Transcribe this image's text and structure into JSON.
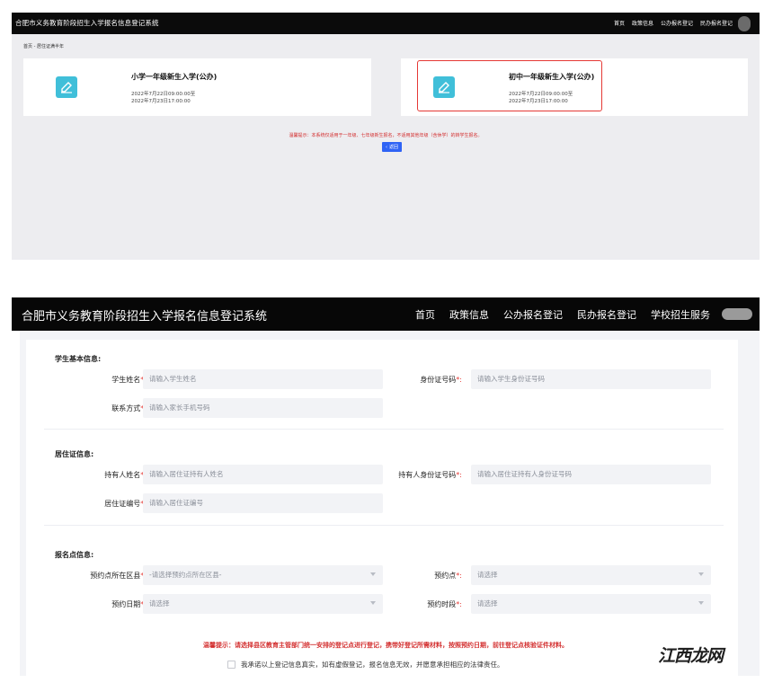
{
  "top": {
    "system_title": "合肥市义务教育阶段招生入学报名信息登记系统",
    "menu": [
      "首页",
      "政策信息",
      "公办报名登记",
      "民办报名登记"
    ],
    "breadcrumb": "首页 - 居住证满半年",
    "cards": [
      {
        "name": "小学一年级新生入学(公办)",
        "time1": "2022年7月22日09:00:00至",
        "time2": "2022年7月23日17:00:00"
      },
      {
        "name": "初中一年级新生入学(公办)",
        "time1": "2022年7月22日09:00:00至",
        "time2": "2022年7月23日17:00:00"
      }
    ],
    "tip": "温馨提示：本系统仅适用于一年级、七年级新生报名，不适用其他年级（含休学）的转学生报名。",
    "back_label": "返回"
  },
  "bottom": {
    "system_title": "合肥市义务教育阶段招生入学报名信息登记系统",
    "menu": [
      "首页",
      "政策信息",
      "公办报名登记",
      "民办报名登记",
      "学校招生服务"
    ],
    "sections": {
      "student": {
        "title": "学生基本信息:",
        "name_label": "学生姓名",
        "name_placeholder": "请输入学生姓名",
        "id_label": "身份证号码",
        "id_placeholder": "请输入学生身份证号码",
        "contact_label": "联系方式",
        "contact_placeholder": "请输入家长手机号码"
      },
      "residence": {
        "title": "居住证信息:",
        "holder_label": "持有人姓名",
        "holder_placeholder": "请输入居住证持有人姓名",
        "holder_id_label": "持有人身份证号码",
        "holder_id_placeholder": "请输入居住证持有人身份证号码",
        "number_label": "居住证编号",
        "number_placeholder": "请输入居住证编号"
      },
      "registration": {
        "title": "报名点信息:",
        "district_label": "预约点所在区县",
        "district_value": "-请选择预约点所在区县-",
        "point_label": "预约点",
        "point_value": "请选择",
        "date_label": "预约日期",
        "date_value": "请选择",
        "slot_label": "预约时段",
        "slot_value": "请选择"
      }
    },
    "tip": "温馨提示：请选择县区教育主管部门统一安排的登记点进行登记，携带好登记所需材料，按照预约日期，前往登记点核验证件材料。",
    "agree_text": "我承诺以上登记信息真实，如有虚假登记，报名信息无效，并愿意承担相应的法律责任。"
  },
  "required_mark": "*:",
  "watermark": "江西龙网",
  "colors": {
    "accent": "#2f63f5",
    "icon": "#40bfd9",
    "warning": "#d32f2f",
    "highlight": "#e53935"
  }
}
